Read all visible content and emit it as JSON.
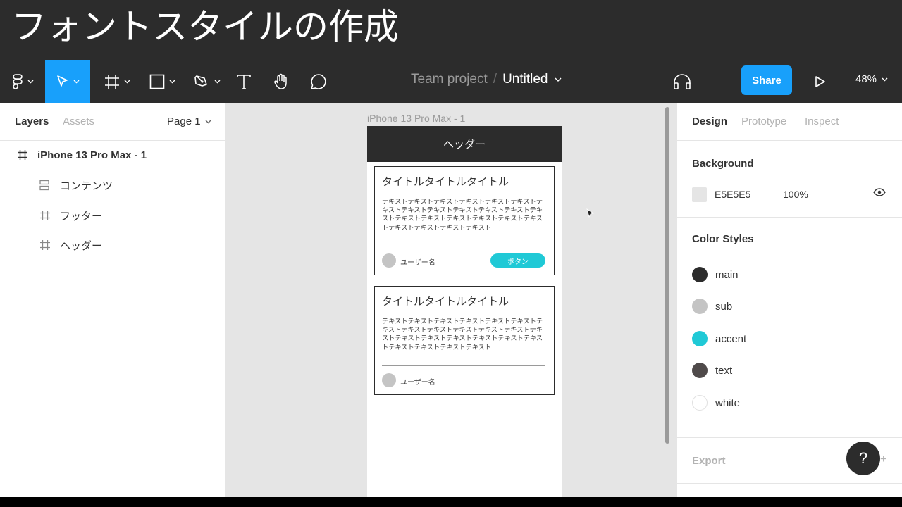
{
  "banner": {
    "title": "フォントスタイルの作成"
  },
  "toolbar": {
    "breadcrumb_team": "Team project",
    "breadcrumb_sep": "/",
    "file_name": "Untitled",
    "share_label": "Share",
    "zoom": "48%",
    "tools": [
      "figma-menu",
      "move",
      "frame",
      "rectangle",
      "pen",
      "text",
      "hand",
      "comment"
    ]
  },
  "left_panel": {
    "tabs": [
      "Layers",
      "Assets"
    ],
    "page": "Page 1",
    "layers": [
      {
        "name": "iPhone 13 Pro Max - 1",
        "icon": "frame-icon"
      },
      {
        "name": "コンテンツ",
        "icon": "auto-layout-icon"
      },
      {
        "name": "フッター",
        "icon": "frame-icon"
      },
      {
        "name": "ヘッダー",
        "icon": "frame-icon"
      }
    ]
  },
  "canvas": {
    "frame_label": "iPhone 13 Pro Max - 1",
    "header_text": "ヘッダー",
    "cards": [
      {
        "title": "タイトルタイトルタイトル",
        "body": "テキストテキストテキストテキストテキストテキストテキストテキストテキストテキストテキストテキストテキストテキストテキストテキストテキストテキストテキストテキストテキストテキストテキスト",
        "user": "ユーザー名",
        "button": "ボタン"
      },
      {
        "title": "タイトルタイトルタイトル",
        "body": "テキストテキストテキストテキストテキストテキストテキストテキストテキストテキストテキストテキストテキストテキストテキストテキストテキストテキストテキストテキストテキストテキストテキスト",
        "user": "ユーザー名"
      }
    ]
  },
  "right_panel": {
    "tabs": [
      "Design",
      "Prototype",
      "Inspect"
    ],
    "background_title": "Background",
    "background_hex": "E5E5E5",
    "background_opacity": "100%",
    "color_styles_title": "Color Styles",
    "color_styles": [
      {
        "name": "main",
        "color": "#2c2c2c"
      },
      {
        "name": "sub",
        "color": "#c4c4c4"
      },
      {
        "name": "accent",
        "color": "#20c9d6"
      },
      {
        "name": "text",
        "color": "#4f4a4a"
      },
      {
        "name": "white",
        "color": "#ffffff"
      }
    ],
    "export_title": "Export",
    "help_label": "?",
    "export_add": "+"
  },
  "colors": {
    "accent_blue": "#18a0fb",
    "dark": "#2c2c2c"
  }
}
